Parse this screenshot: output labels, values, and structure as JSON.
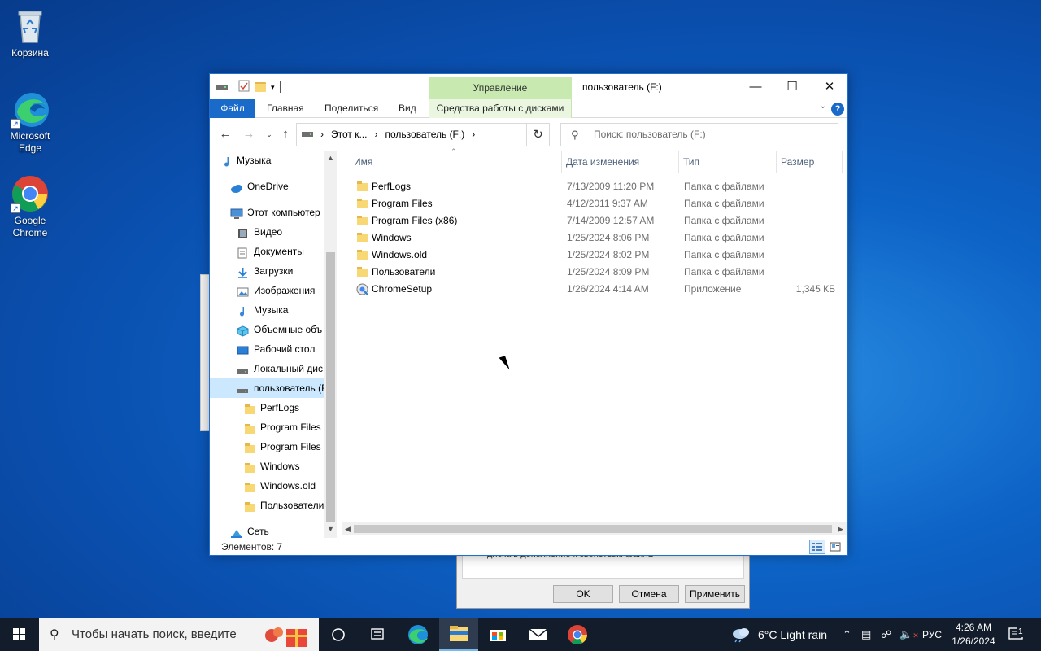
{
  "desktop": {
    "icons": [
      {
        "label_line1": "Корзина",
        "label_line2": ""
      },
      {
        "label_line1": "Microsoft",
        "label_line2": "Edge"
      },
      {
        "label_line1": "Google",
        "label_line2": "Chrome"
      }
    ]
  },
  "background_dialog": {
    "text": "диска в дополнение к свойствам файла",
    "ok": "OK",
    "cancel": "Отмена",
    "apply": "Применить"
  },
  "window": {
    "title": "пользователь (F:)",
    "contextual_group": "Управление",
    "ribbon_tabs": {
      "file": "Файл",
      "home": "Главная",
      "share": "Поделиться",
      "view": "Вид",
      "drive_tools": "Средства работы с дисками"
    },
    "address": {
      "crumb1": "Этот к...",
      "crumb2": "пользователь (F:)"
    },
    "search_placeholder": "Поиск: пользователь (F:)",
    "columns": {
      "name": "Имя",
      "date": "Дата изменения",
      "type": "Тип",
      "size": "Размер"
    },
    "files": [
      {
        "name": "PerfLogs",
        "date": "7/13/2009 11:20 PM",
        "type": "Папка с файлами",
        "size": "",
        "kind": "folder"
      },
      {
        "name": "Program Files",
        "date": "4/12/2011 9:37 AM",
        "type": "Папка с файлами",
        "size": "",
        "kind": "folder"
      },
      {
        "name": "Program Files (x86)",
        "date": "7/14/2009 12:57 AM",
        "type": "Папка с файлами",
        "size": "",
        "kind": "folder"
      },
      {
        "name": "Windows",
        "date": "1/25/2024 8:06 PM",
        "type": "Папка с файлами",
        "size": "",
        "kind": "folder"
      },
      {
        "name": "Windows.old",
        "date": "1/25/2024 8:02 PM",
        "type": "Папка с файлами",
        "size": "",
        "kind": "folder"
      },
      {
        "name": "Пользователи",
        "date": "1/25/2024 8:09 PM",
        "type": "Папка с файлами",
        "size": "",
        "kind": "folder"
      },
      {
        "name": "ChromeSetup",
        "date": "1/26/2024 4:14 AM",
        "type": "Приложение",
        "size": "1,345 КБ",
        "kind": "app"
      }
    ],
    "nav": [
      {
        "label": "Музыка",
        "icon": "music-icon"
      },
      {
        "label": "OneDrive",
        "icon": "cloud-icon"
      },
      {
        "label": "Этот компьютер",
        "icon": "computer-icon"
      },
      {
        "label": "Видео",
        "icon": "video-icon"
      },
      {
        "label": "Документы",
        "icon": "documents-icon"
      },
      {
        "label": "Загрузки",
        "icon": "download-icon"
      },
      {
        "label": "Изображения",
        "icon": "pictures-icon"
      },
      {
        "label": "Музыка",
        "icon": "music-icon"
      },
      {
        "label": "Объемные объ",
        "icon": "3d-objects-icon"
      },
      {
        "label": "Рабочий стол",
        "icon": "desktop-icon"
      },
      {
        "label": "Локальный дис",
        "icon": "drive-icon"
      },
      {
        "label": "пользователь (F:",
        "icon": "drive-icon"
      },
      {
        "label": "PerfLogs",
        "icon": "folder-icon"
      },
      {
        "label": "Program Files",
        "icon": "folder-icon"
      },
      {
        "label": "Program Files (",
        "icon": "folder-icon"
      },
      {
        "label": "Windows",
        "icon": "folder-icon"
      },
      {
        "label": "Windows.old",
        "icon": "folder-icon"
      },
      {
        "label": "Пользователи",
        "icon": "folder-icon"
      },
      {
        "label": "Сеть",
        "icon": "network-icon"
      }
    ],
    "status": "Элементов: 7"
  },
  "taskbar": {
    "search_placeholder": "Чтобы начать поиск, введите",
    "weather": "6°C  Light rain",
    "language": "РУС",
    "time": "4:26 AM",
    "date": "1/26/2024",
    "notification_count": "1"
  },
  "colors": {
    "accent": "#1a6ac9",
    "contextual_tab": "#c8eab0",
    "selection": "#cce8ff",
    "taskbar": "#131c2b"
  }
}
